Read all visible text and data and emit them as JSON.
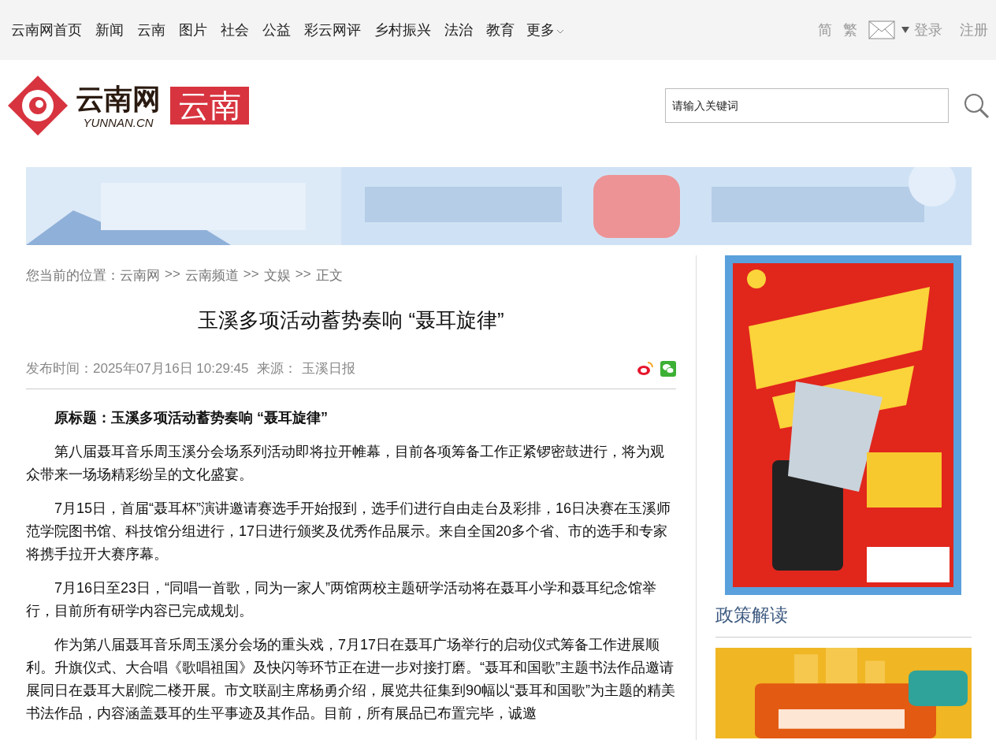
{
  "top_nav": {
    "links": [
      "云南网首页",
      "新闻",
      "云南",
      "图片",
      "社会",
      "公益",
      "彩云网评",
      "乡村振兴",
      "法治",
      "教育"
    ],
    "more": "更多",
    "right_links": [
      "简",
      "繁"
    ],
    "account_links": [
      "登录",
      "注册"
    ]
  },
  "header": {
    "logo": {
      "name": "云南网",
      "domain": "YUNNAN.CN",
      "channel": "云南"
    },
    "search": {
      "placeholder": "请输入关键词"
    }
  },
  "breadcrumb": {
    "prefix": "您当前的位置：",
    "items": [
      "云南网",
      "云南频道",
      "文娱",
      "正文"
    ],
    "separator": ">>"
  },
  "article": {
    "title": "玉溪多项活动蓄势奏响 “聂耳旋律”",
    "published": "发布时间：2025年07月16日 10:29:45",
    "source_label": "来源：",
    "source": "玉溪日报",
    "paragraphs": [
      {
        "kind": "lead",
        "text": "原标题：玉溪多项活动蓄势奏响 “聂耳旋律”"
      },
      {
        "kind": "body",
        "text": "第八届聂耳音乐周玉溪分会场系列活动即将拉开帷幕，目前各项筹备工作正紧锣密鼓进行，将为观众带来一场场精彩纷呈的文化盛宴。"
      },
      {
        "kind": "body",
        "text": "7月15日，首届“聂耳杯”演讲邀请赛选手开始报到，选手们进行自由走台及彩排，16日决赛在玉溪师范学院图书馆、科技馆分组进行，17日进行颁奖及优秀作品展示。来自全国20多个省、市的选手和专家将携手拉开大赛序幕。"
      },
      {
        "kind": "body",
        "text": "7月16日至23日，“同唱一首歌，同为一家人”两馆两校主题研学活动将在聂耳小学和聂耳纪念馆举行，目前所有研学内容已完成规划。"
      },
      {
        "kind": "body",
        "text": "作为第八届聂耳音乐周玉溪分会场的重头戏，7月17日在聂耳广场举行的启动仪式筹备工作进展顺利。升旗仪式、大合唱《歌唱祖国》及快闪等环节正在进一步对接打磨。“聂耳和国歌”主题书法作品邀请展同日在聂耳大剧院二楼开展。市文联副主席杨勇介绍，展览共征集到90幅以“聂耳和国歌”为主题的精美书法作品，内容涵盖聂耳的生平事迹及其作品。目前，所有展品已布置完毕，诚邀"
      }
    ]
  },
  "sidebar": {
    "section_title": "政策解读"
  }
}
